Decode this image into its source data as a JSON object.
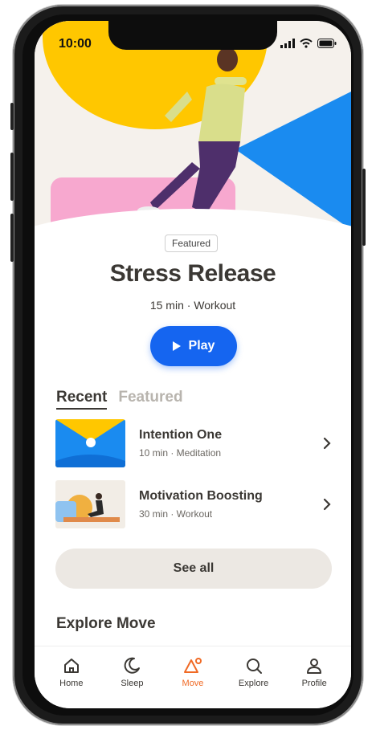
{
  "status_bar": {
    "time": "10:00"
  },
  "hero": {
    "badge": "Featured",
    "title": "Stress Release",
    "meta": "15 min · Workout",
    "play_label": "Play"
  },
  "tabs": {
    "recent": "Recent",
    "featured": "Featured"
  },
  "recent_items": [
    {
      "title": "Intention One",
      "meta": "10 min · Meditation"
    },
    {
      "title": "Motivation Boosting",
      "meta": "30 min · Workout"
    }
  ],
  "see_all_label": "See all",
  "explore_title": "Explore Move",
  "tabbar": [
    {
      "label": "Home",
      "icon": "home-icon"
    },
    {
      "label": "Sleep",
      "icon": "moon-icon"
    },
    {
      "label": "Move",
      "icon": "move-icon"
    },
    {
      "label": "Explore",
      "icon": "search-icon"
    },
    {
      "label": "Profile",
      "icon": "person-icon"
    }
  ],
  "colors": {
    "accent_blue": "#1565f0",
    "accent_orange": "#f06a25",
    "yellow": "#ffc700",
    "pink": "#f7a8cf",
    "text_dark": "#3b3834"
  }
}
